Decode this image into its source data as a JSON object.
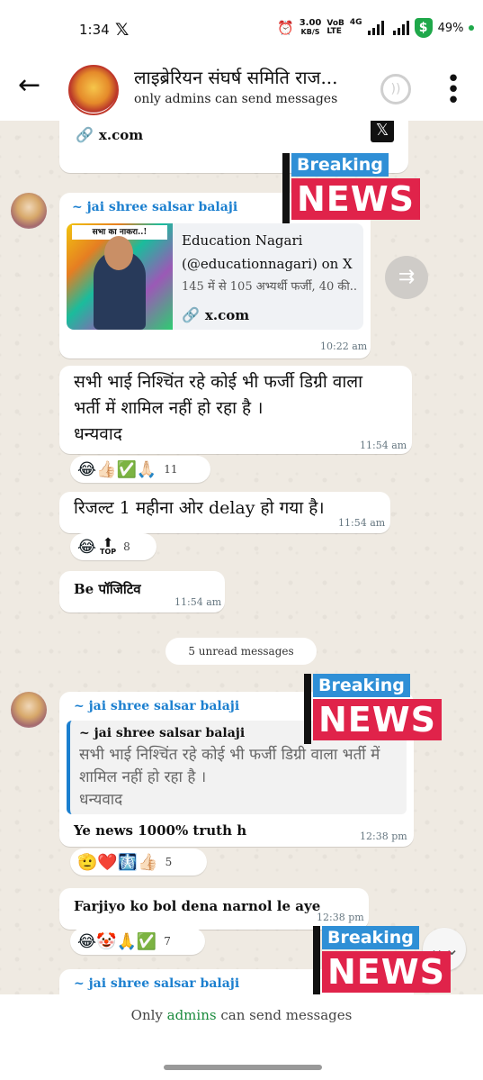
{
  "status_bar": {
    "time": "1:34",
    "x_app": "𝕏",
    "speed_value": "3.00",
    "speed_unit": "KB/S",
    "network_top": "VoB",
    "network_bottom": "LTE",
    "network_type": "4G",
    "shield_glyph": "$",
    "battery": "49%"
  },
  "header": {
    "back_glyph": "←",
    "group_name": "लाइब्रेरियन संघर्ष समिति राज...",
    "subtitle": "only admins can send messages",
    "menu_glyph": "⋮",
    "call_icon": "voice-chat-icon",
    "call_glyph": "))"
  },
  "messages": {
    "m0": {
      "link_text": "x.com",
      "x_logo": "𝕏"
    },
    "m1": {
      "sender": "~ jai shree salsar balaji",
      "banner_text": "सभा का नाकरा..!",
      "card_title": "Education Nagari",
      "card_title2": "(@educationnagari) on X",
      "card_desc": "145 में से 105 अभ्यर्थी फर्जी, 40 की...",
      "card_link": "x.com",
      "time": "10:22 am"
    },
    "m2": {
      "line1": "सभी भाई निश्चिंत रहे कोई भी फर्जी डिग्री वाला",
      "line2": "भर्ती में शामिल नहीं हो रहा है ।",
      "line3": "धन्यवाद",
      "time": "11:54 am",
      "reactions": "😂👍🏻✅🙏🏻",
      "reaction_count": "11"
    },
    "m3": {
      "text": "रिजल्ट 1 महीना ओर delay हो गया है।",
      "time": "11:54 am",
      "reaction_emoji": "😂",
      "top_badge_arrow": "⬆",
      "top_badge_label": "TOP",
      "reaction_count": "8"
    },
    "m4": {
      "text": "Be पॉजिटिव",
      "time": "11:54 am"
    },
    "unread": "5 unread messages",
    "m5": {
      "sender": "~ jai shree salsar balaji",
      "quote_sender": "~ jai shree salsar balaji",
      "quote_line1": "सभी भाई निश्चिंत रहे कोई भी फर्जी डिग्री वाला भर्ती में",
      "quote_line2": "शामिल नहीं हो रहा है ।",
      "quote_line3": "धन्यवाद",
      "text": "Ye news 1000% truth h",
      "time": "12:38 pm",
      "reactions": "🫡❤️🩻👍🏻",
      "reaction_count": "5"
    },
    "m6": {
      "text": "Farjiyo ko bol dena narnol le aye",
      "time": "12:38 pm",
      "reactions": "😂🤡🙏✅",
      "reaction_count": "7"
    },
    "m7": {
      "sender": "~ jai shree salsar balaji"
    }
  },
  "overlay": {
    "breaking": "Breaking",
    "news": "NEWS"
  },
  "forward_glyph": "⇉",
  "scroll_glyph": "⌄⌄",
  "footer": {
    "prefix": "Only ",
    "admins": "admins",
    "suffix": " can send messages"
  }
}
